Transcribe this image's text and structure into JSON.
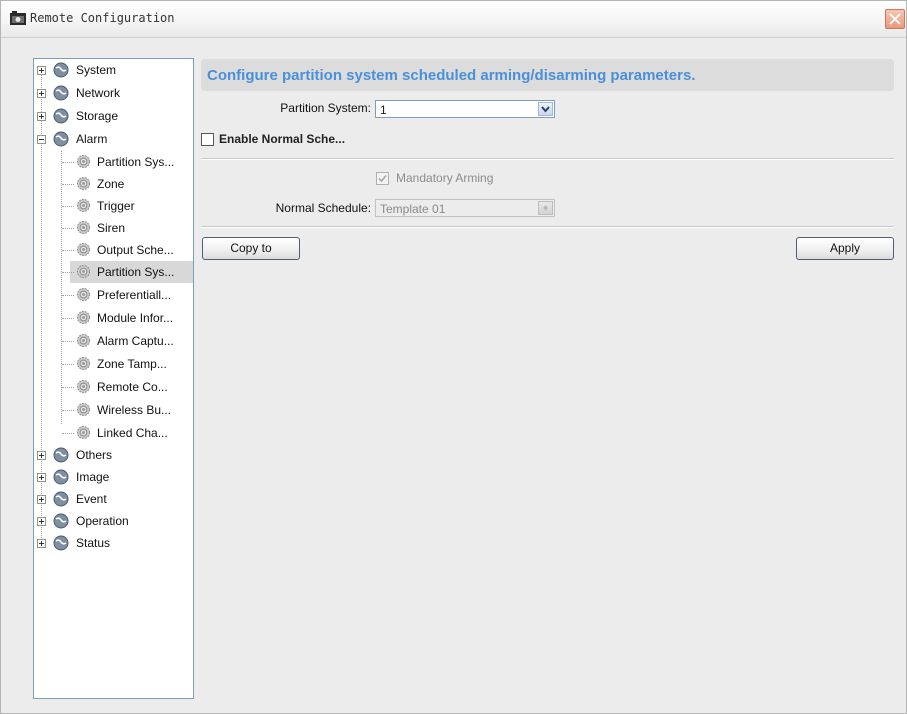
{
  "window": {
    "title": "Remote Configuration"
  },
  "tree": {
    "nodes": [
      {
        "label": "System",
        "expanded": false
      },
      {
        "label": "Network",
        "expanded": false
      },
      {
        "label": "Storage",
        "expanded": false
      },
      {
        "label": "Alarm",
        "expanded": true,
        "children": [
          "Partition Sys...",
          "Zone",
          "Trigger",
          "Siren",
          "Output Sche...",
          "Partition Sys...",
          "Preferentiall...",
          "Module Infor...",
          "Alarm Captu...",
          "Zone Tamp...",
          "Remote Co...",
          "Wireless Bu...",
          "Linked Cha..."
        ],
        "selected_child_index": 5
      },
      {
        "label": "Others",
        "expanded": false
      },
      {
        "label": "Image",
        "expanded": false
      },
      {
        "label": "Event",
        "expanded": false
      },
      {
        "label": "Operation",
        "expanded": false
      },
      {
        "label": "Status",
        "expanded": false
      }
    ]
  },
  "panel": {
    "header": "Configure partition system scheduled arming/disarming parameters.",
    "partition_label": "Partition System:",
    "partition_value": "1",
    "enable_label": "Enable Normal Sche...",
    "mandatory_label": "Mandatory Arming",
    "schedule_label": "Normal Schedule:",
    "schedule_value": "Template 01",
    "copy_label": "Copy to",
    "apply_label": "Apply"
  },
  "colors": {
    "header_text": "#4a90d9",
    "selection": "#d8d8d8"
  }
}
